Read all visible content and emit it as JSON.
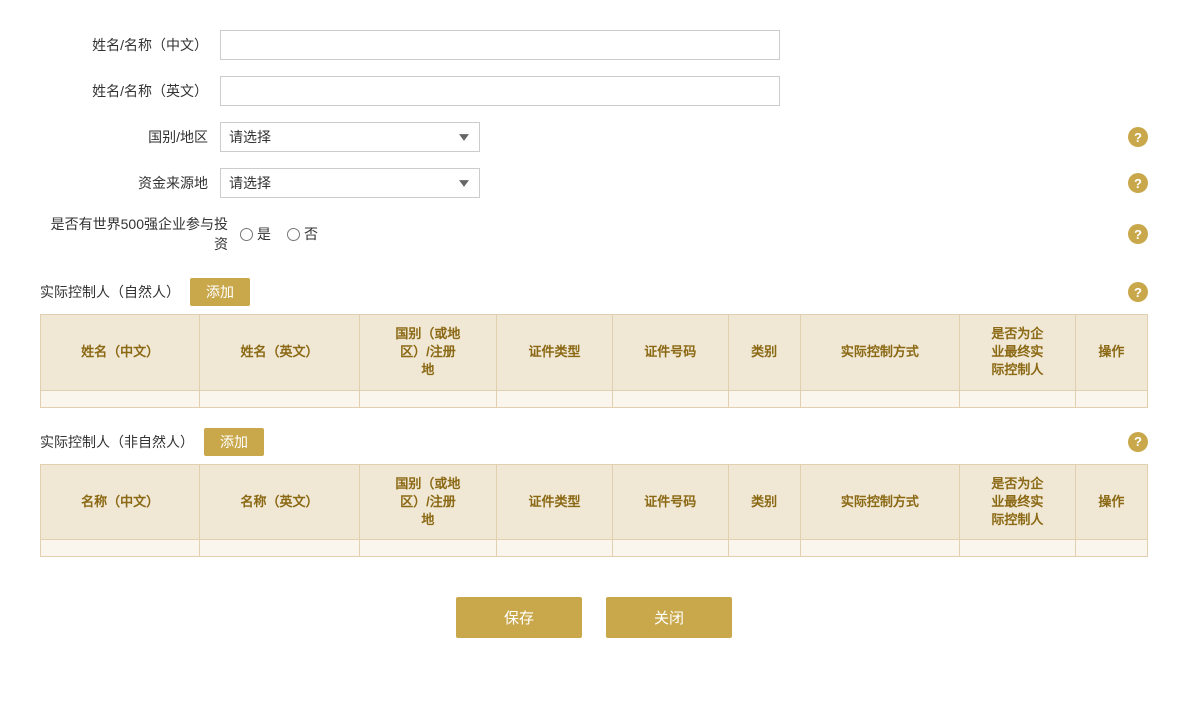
{
  "form": {
    "name_cn_label": "姓名/名称（中文）",
    "name_en_label": "姓名/名称（英文）",
    "country_label": "国别/地区",
    "funds_source_label": "资金来源地",
    "world500_label": "是否有世界500强企业参与投资",
    "yes_label": "是",
    "no_label": "否",
    "country_placeholder": "请选择",
    "funds_placeholder": "请选择"
  },
  "natural_person": {
    "section_title": "实际控制人（自然人）",
    "add_label": "添加",
    "columns": [
      "姓名（中文）",
      "姓名（英文）",
      "国别（或地区）/注册地",
      "证件类型",
      "证件号码",
      "类别",
      "实际控制方式",
      "是否为企业最终实际控制人",
      "操作"
    ]
  },
  "non_natural_person": {
    "section_title": "实际控制人（非自然人）",
    "add_label": "添加",
    "columns": [
      "名称（中文）",
      "名称（英文）",
      "国别（或地区）/注册地",
      "证件类型",
      "证件号码",
      "类别",
      "实际控制方式",
      "是否为企业最终实际控制人",
      "操作"
    ]
  },
  "footer": {
    "save_label": "保存",
    "close_label": "关闭"
  },
  "help_icon_text": "?"
}
